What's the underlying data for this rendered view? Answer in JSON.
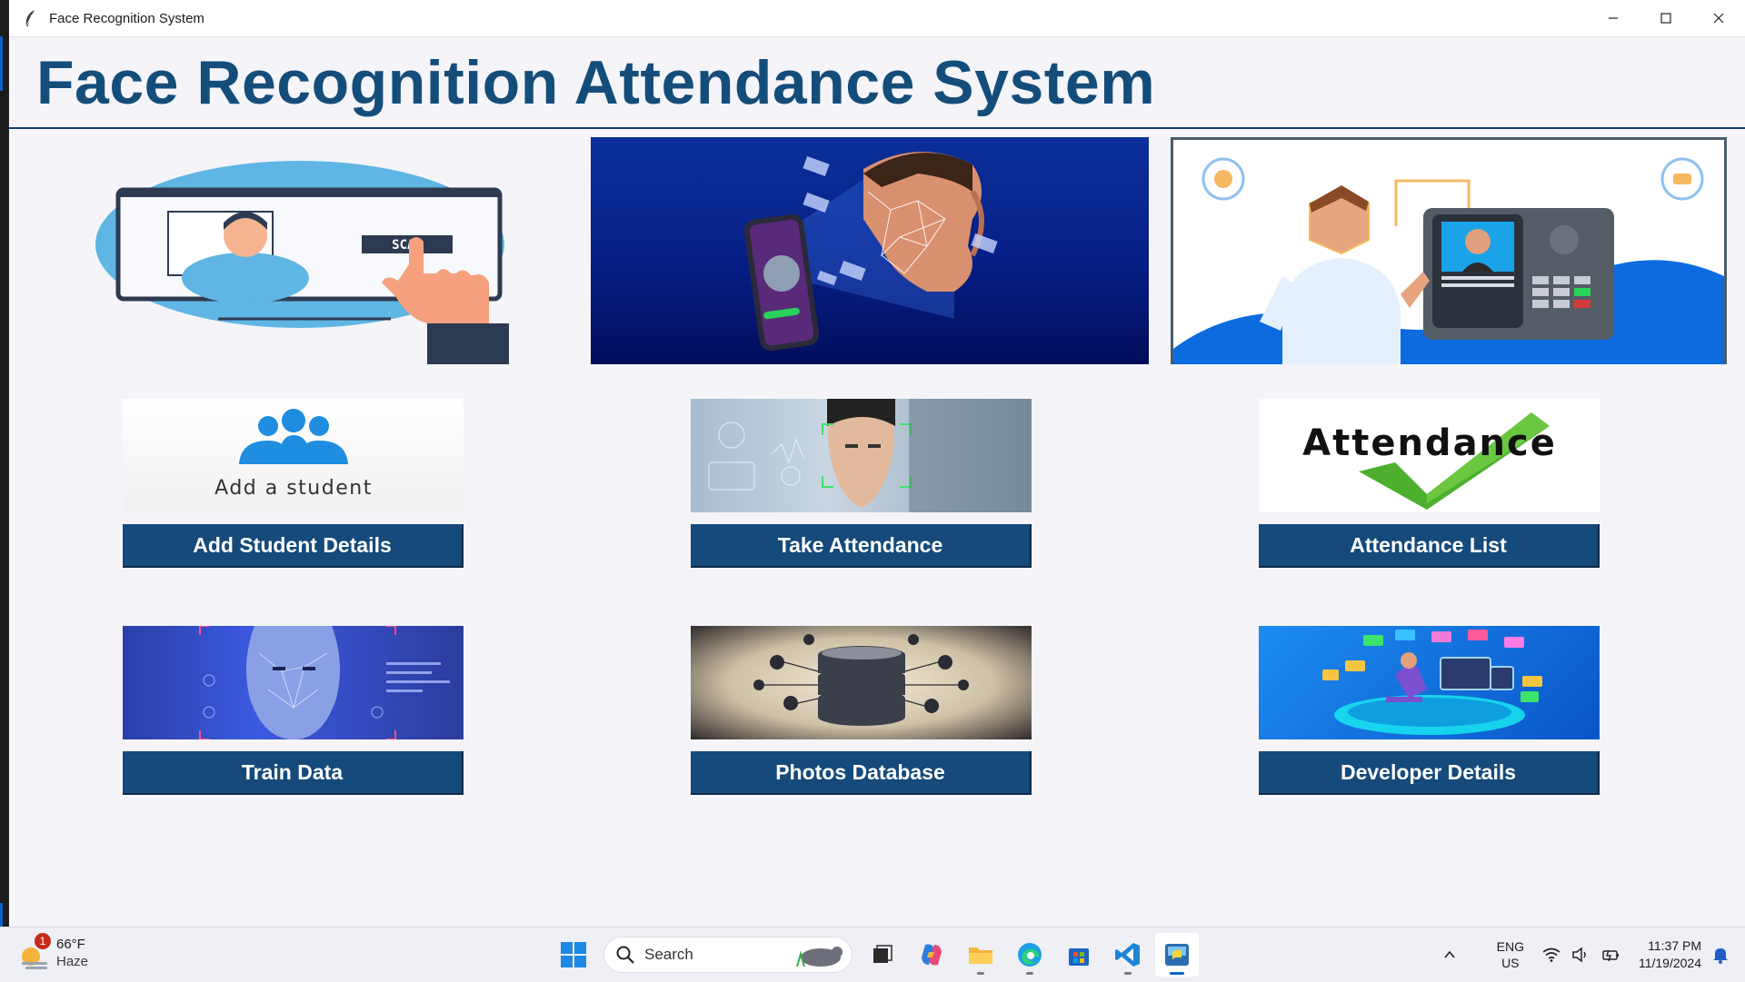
{
  "window": {
    "title": "Face Recognition System",
    "header_title": "Face Recognition Attendance System"
  },
  "banners": [
    {
      "name": "scan-banner",
      "scan_text": "SCAN"
    },
    {
      "name": "face-phone-banner"
    },
    {
      "name": "attendance-terminal-banner"
    }
  ],
  "tiles": [
    {
      "image_caption": "Add a student",
      "label": "Add Student Details"
    },
    {
      "label": "Take Attendance"
    },
    {
      "image_caption": "Attendance",
      "label": "Attendance List"
    },
    {
      "label": "Train Data"
    },
    {
      "label": "Photos Database"
    },
    {
      "label": "Developer Details"
    }
  ],
  "taskbar": {
    "weather": {
      "temp": "66°F",
      "condition": "Haze",
      "badge": "1"
    },
    "search_placeholder": "Search",
    "language": {
      "line1": "ENG",
      "line2": "US"
    },
    "time": "11:37 PM",
    "date": "11/19/2024"
  },
  "colors": {
    "header_text": "#154d7a",
    "button_bg": "#154a7a",
    "window_bg": "#f4f4f9"
  }
}
